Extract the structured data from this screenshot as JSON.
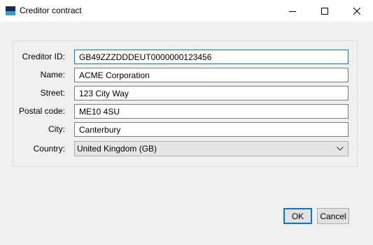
{
  "window": {
    "title": "Creditor contract",
    "app_icon": "app-icon",
    "controls": [
      "minimize-icon",
      "maximize-icon",
      "close-icon"
    ]
  },
  "form": {
    "creditor_id": {
      "label": "Creditor ID:",
      "value": "GB49ZZZDDDEUT0000000123456"
    },
    "name": {
      "label": "Name:",
      "value": "ACME Corporation"
    },
    "street": {
      "label": "Street:",
      "value": "123 City Way"
    },
    "postal_code": {
      "label": "Postal code:",
      "value": "ME10 4SU"
    },
    "city": {
      "label": "City:",
      "value": "Canterbury"
    },
    "country": {
      "label": "Country:",
      "value": "United Kingdom (GB)"
    }
  },
  "buttons": {
    "ok": "OK",
    "cancel": "Cancel"
  },
  "colors": {
    "focus_accent": "#0078d7",
    "background": "#f0f0f0"
  }
}
